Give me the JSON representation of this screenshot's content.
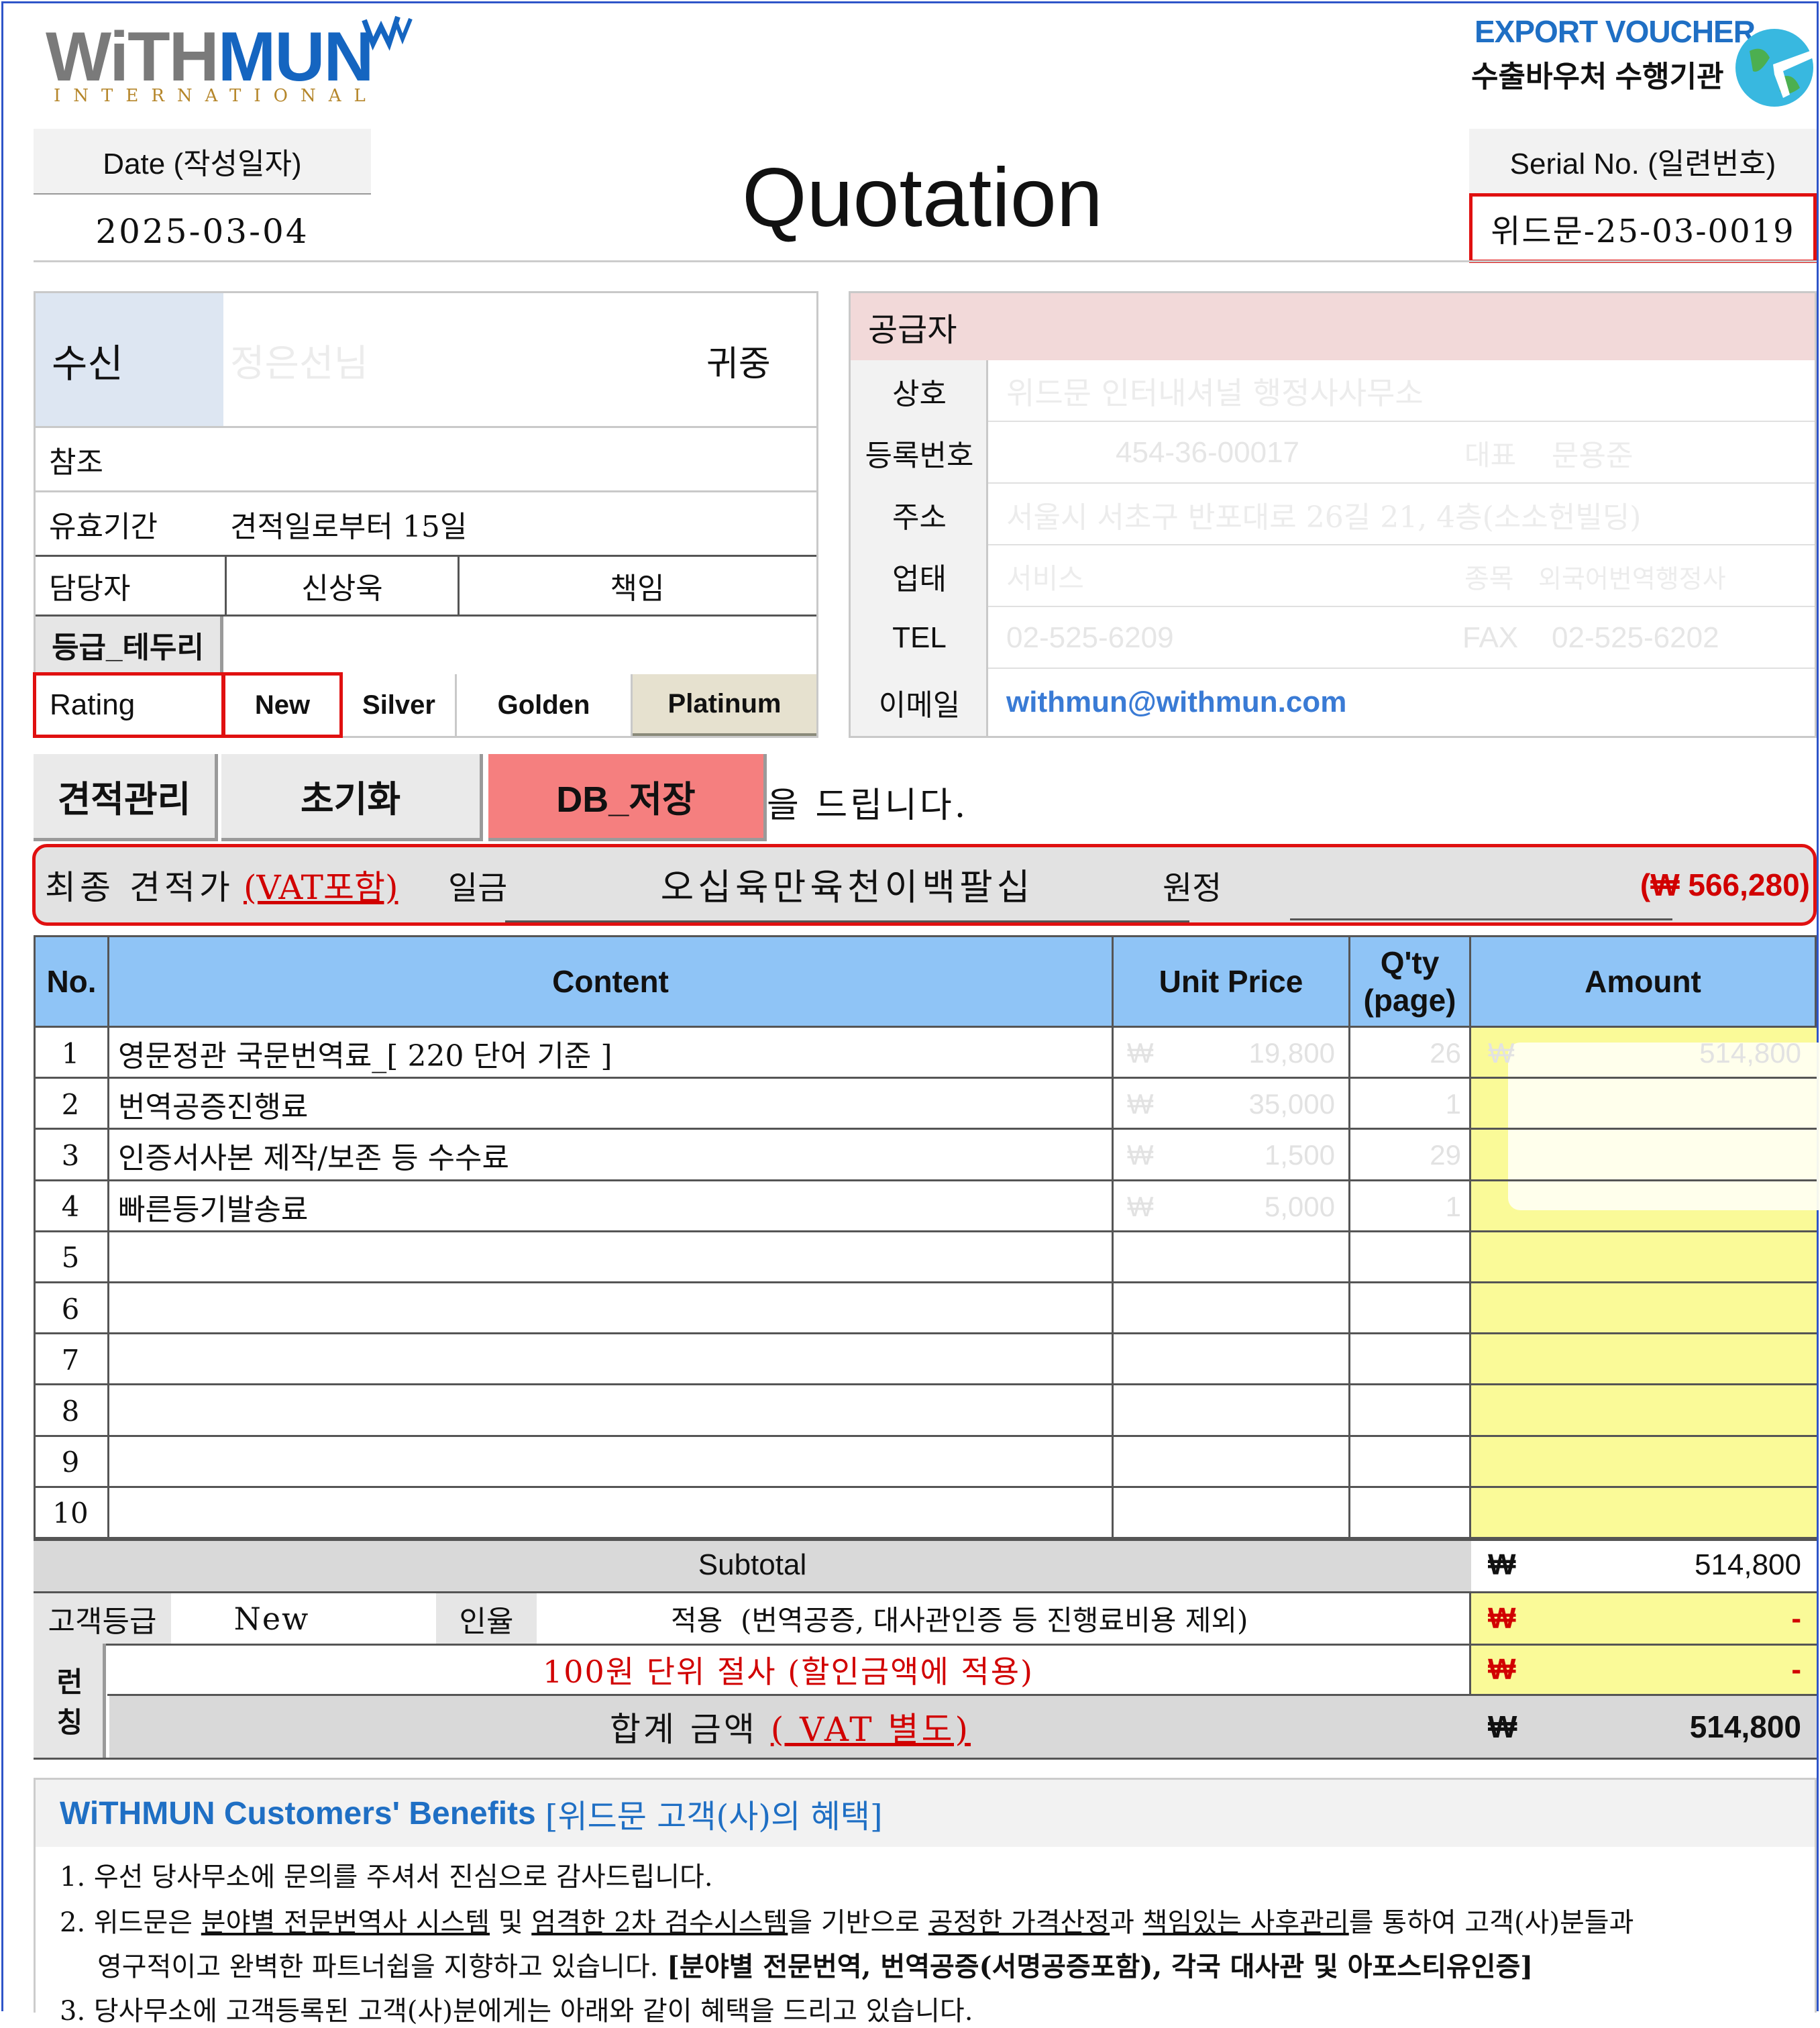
{
  "logo": {
    "brand_a": "WiTH",
    "brand_b": "MUN",
    "sub": "INTERNATIONAL"
  },
  "voucher": {
    "line1": "EXPORT VOUCHER",
    "line2": "수출바우처 수행기관"
  },
  "date": {
    "label": "Date (작성일자)",
    "value": "2025-03-04"
  },
  "title": "Quotation",
  "serial": {
    "label": "Serial No. (일련번호)",
    "value": "위드문-25-03-0019"
  },
  "recipient": {
    "label": "수신",
    "name": "정은선님",
    "honorific": "귀중",
    "ref_label": "참조",
    "ref_value": "",
    "validity_label": "유효기간",
    "validity_value": "견적일로부터 15일",
    "manager_label": "담당자",
    "manager_name": "신상욱",
    "manager_title": "책임",
    "grade_border_btn": "등급_테두리",
    "rating_label": "Rating",
    "ratings": [
      "New",
      "Silver",
      "Golden",
      "Platinum"
    ]
  },
  "supplier": {
    "header": "공급자",
    "company_label": "상호",
    "company_value": "위드문 인터내셔널 행정사사무소",
    "regno_label": "등록번호",
    "regno_value": "454-36-00017",
    "ceo_label": "대표",
    "ceo_value": "문용준",
    "address_label": "주소",
    "address_value": "서울시 서초구 반포대로 26길 21, 4층(소소헌빌딩)",
    "biztype_label": "업태",
    "biztype_value": "서비스",
    "item_label": "종목",
    "item_value": "외국어번역행정사",
    "tel_label": "TEL",
    "tel_value": "02-525-6209",
    "fax_label": "FAX",
    "fax_value": "02-525-6202",
    "email_label": "이메일",
    "email_value": "withmun@withmun.com"
  },
  "actions": {
    "manage": "견적관리",
    "reset": "초기화",
    "db_save": "DB_저장",
    "suffix": "을 드립니다."
  },
  "final": {
    "label": "최종 견적가",
    "vat": "(VAT포함)",
    "prefix": "일금",
    "amount_korean": "오십육만육천이백팔십",
    "suffix": "원정",
    "amount": "(₩ 566,280)"
  },
  "table": {
    "headers": {
      "no": "No.",
      "content": "Content",
      "unit_price": "Unit Price",
      "qty": "Q'ty\n(page)",
      "amount": "Amount"
    },
    "currency": "₩",
    "rows": [
      {
        "no": "1",
        "content": "영문정관 국문번역료_[ 220 단어 기준 ]",
        "price": "19,800",
        "qty": "26",
        "amount": "514,800"
      },
      {
        "no": "2",
        "content": "번역공증진행료",
        "price": "35,000",
        "qty": "1",
        "amount": ""
      },
      {
        "no": "3",
        "content": "인증서사본 제작/보존 등 수수료",
        "price": "1,500",
        "qty": "29",
        "amount": ""
      },
      {
        "no": "4",
        "content": "빠른등기발송료",
        "price": "5,000",
        "qty": "1",
        "amount": ""
      },
      {
        "no": "5",
        "content": "",
        "price": "",
        "qty": "",
        "amount": ""
      },
      {
        "no": "6",
        "content": "",
        "price": "",
        "qty": "",
        "amount": ""
      },
      {
        "no": "7",
        "content": "",
        "price": "",
        "qty": "",
        "amount": ""
      },
      {
        "no": "8",
        "content": "",
        "price": "",
        "qty": "",
        "amount": ""
      },
      {
        "no": "9",
        "content": "",
        "price": "",
        "qty": "",
        "amount": ""
      },
      {
        "no": "10",
        "content": "",
        "price": "",
        "qty": "",
        "amount": ""
      }
    ],
    "subtotal_label": "Subtotal",
    "subtotal_value": "514,800",
    "grade_label": "고객등급",
    "grade_value": "New",
    "rate_label": "인율",
    "apply_text": "적용  (번역공증, 대사관인증 등 진행료비용 제외)",
    "discount_value": "-",
    "side_label_1": "런",
    "side_label_2": "칭",
    "rounding_text": "100원 단위 절사 (할인금액에 적용)",
    "rounding_value": "-",
    "total_label": "합계 금액",
    "total_vat": "( VAT 별도)",
    "total_value": "514,800"
  },
  "benefits": {
    "title_en": "WiTHMUN Customers' Benefits",
    "title_ko": "[위드문 고객(사)의 혜택]",
    "line1": "1. 우선 당사무소에 문의를 주셔서 진심으로 감사드립니다.",
    "line2_a": "2. 위드문은 ",
    "line2_b": "분야별 전문번역사 시스템",
    "line2_c": " 및 ",
    "line2_d": "엄격한 2차 검수시스템",
    "line2_e": "을 기반으로 ",
    "line2_f": "공정한 가격산정",
    "line2_g": "과 ",
    "line2_h": "책임있는 사후관리",
    "line2_i": "를 통하여 고객(사)분들과",
    "line3_a": "영구적이고 완벽한 파트너쉽을 지향하고 있습니다. ",
    "line3_b": "[분야별 전문번역, 번역공증(서명공증포함), 각국 대사관 및 아포스티유인증]",
    "line4": "3. 당사무소에 고객등록된 고객(사)분에게는 아래와 같이 혜택을 드리고 있습니다."
  }
}
